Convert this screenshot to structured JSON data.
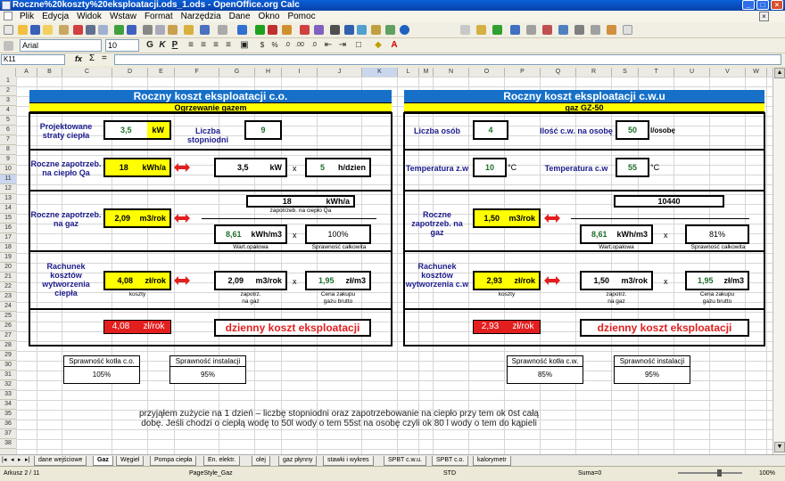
{
  "window": {
    "title": "Roczne%20koszty%20eksploatacji.ods_1.ods - OpenOffice.org Calc"
  },
  "menu": [
    "Plik",
    "Edycja",
    "Widok",
    "Wstaw",
    "Format",
    "Narzędzia",
    "Dane",
    "Okno",
    "Pomoc"
  ],
  "toolbar": {
    "font_name": "Arial",
    "font_size": "10"
  },
  "formula_bar": {
    "cell_ref": "K11",
    "fx": "fx",
    "sum": "Σ",
    "eq": "="
  },
  "columns": [
    "A",
    "B",
    "C",
    "D",
    "E",
    "F",
    "G",
    "H",
    "I",
    "J",
    "K",
    "L",
    "M",
    "N",
    "O",
    "P",
    "Q",
    "R",
    "S",
    "T",
    "U",
    "V",
    "W",
    "X"
  ],
  "selected_col": "K",
  "rows": [
    "1",
    "2",
    "3",
    "4",
    "5",
    "6",
    "7",
    "8",
    "9",
    "10",
    "11",
    "12",
    "13",
    "14",
    "15",
    "16",
    "17",
    "18",
    "19",
    "20",
    "21",
    "22",
    "23",
    "24",
    "25",
    "26",
    "27",
    "28",
    "29",
    "30",
    "31",
    "32",
    "33",
    "34",
    "35",
    "36",
    "37",
    "38"
  ],
  "selected_row": "11",
  "co": {
    "title": "Roczny koszt eksploatacji c.o.",
    "subtitle": "Ogrzewanie gazem",
    "straty_label": "Projektowane straty ciepła",
    "straty_value": "3,5",
    "straty_unit": "kW",
    "stopniodni_label": "Liczba stopniodni",
    "stopniodni_value": "9",
    "zapotrz_label": "Roczne zapotrzeb. na ciepło Qa",
    "zapotrz_value": "18",
    "zapotrz_unit": "kWh/a",
    "calc1_a": "3,5",
    "calc1_a_unit": "kW",
    "times": "x",
    "calc1_b": "5",
    "calc1_b_unit": "h/dzien",
    "gaz_label": "Roczne zapotrzeb. na gaz",
    "gaz_value": "2,09",
    "gaz_unit": "m3/rok",
    "num_value": "18",
    "num_unit": "kWh/a",
    "num_caption": "zapotrzeb. na ciepło Qa",
    "den_a": "8,61",
    "den_a_unit": "kWh/m3",
    "den_b": "100%",
    "den_a_caption": "Wart.opałowa",
    "den_b_caption": "Sprawność całkowita",
    "rach_label": "Rachunek kosztów wytworzenia ciepła",
    "rach_value": "4,08",
    "rach_unit": "zł/rok",
    "rach_caption": "koszty",
    "r_a": "2,09",
    "r_a_unit": "m3/rok",
    "r_a_caption1": "zapotrz.",
    "r_a_caption2": "na gaz",
    "r_b": "1,95",
    "r_b_unit": "zł/m3",
    "r_b_caption1": "Cena zakupu",
    "r_b_caption2": "gazu brutto",
    "daily_value": "4,08",
    "daily_unit": "zł/rok",
    "daily_label": "dzienny koszt eksploatacji",
    "eff1_label": "Sprawność kotła c.o.",
    "eff1_value": "105%",
    "eff2_label": "Sprawność instalacji",
    "eff2_value": "95%"
  },
  "cwu": {
    "title": "Roczny koszt eksploatacji c.w.u",
    "subtitle": "gaz GZ-50",
    "osob_label": "Liczba osób",
    "osob_value": "4",
    "ilosc_label": "Ilość c.w. na osobę",
    "ilosc_value": "50",
    "ilosc_unit": "l/osobę",
    "tz_label": "Temperatura z.w",
    "tz_value": "10",
    "tz_unit": "°C",
    "tc_label": "Temperatura c.w",
    "tc_value": "55",
    "tc_unit": "°C",
    "gaz_label": "Roczne zapotrzeb. na gaz",
    "gaz_value": "1,50",
    "gaz_unit": "m3/rok",
    "num_value": "10440",
    "den_a": "8,61",
    "den_a_unit": "kWh/m3",
    "den_b": "81%",
    "den_a_caption": "Wart.opałowa",
    "den_b_caption": "Sprawność całkowita",
    "rach_label": "Rachunek kosztów wytworzenia c.w",
    "rach_value": "2,93",
    "rach_unit": "zł/rok",
    "rach_caption": "koszty",
    "r_a": "1,50",
    "r_a_unit": "m3/rok",
    "r_a_caption1": "zapotrz.",
    "r_a_caption2": "na gaz",
    "r_b": "1,95",
    "r_b_unit": "zł/m3",
    "r_b_caption1": "Cena zakupu",
    "r_b_caption2": "gazu brutto",
    "daily_value": "2,93",
    "daily_unit": "zł/rok",
    "daily_label": "dzienny koszt eksploatacji",
    "eff1_label": "Sprawność kotła c.w.",
    "eff1_value": "85%",
    "eff2_label": "Sprawność instalacji",
    "eff2_value": "95%"
  },
  "note": "przyjąłem zużycie na 1 dzień – liczbę stopniodni oraz zapotrzebowanie na ciepło przy tem ok 0st całą dobę. Jeśli chodzi o ciepłą wodę to 50l wody o tem 55st na osobę czyli ok 80 l wody o tem do kąpieli",
  "sheet_tabs": [
    "dane wejściowe",
    "Gaz",
    "Węgiel",
    "Pompa ciepła",
    "En. elektr.",
    "olej",
    "gaz płynny",
    "stawki i wykres",
    "SPBT c.w.u.",
    "SPBT c.o.",
    "kalorymetr"
  ],
  "active_tab": "Gaz",
  "status": {
    "sheet": "Arkusz 2 / 11",
    "style": "PageStyle_Gaz",
    "mode": "STD",
    "sum": "Suma=0",
    "zoom": "100%"
  },
  "colors": {
    "title_blue": "#1670c8",
    "yellow": "#ffff00",
    "red": "#e31e1e",
    "green": "#1d6f2a"
  }
}
